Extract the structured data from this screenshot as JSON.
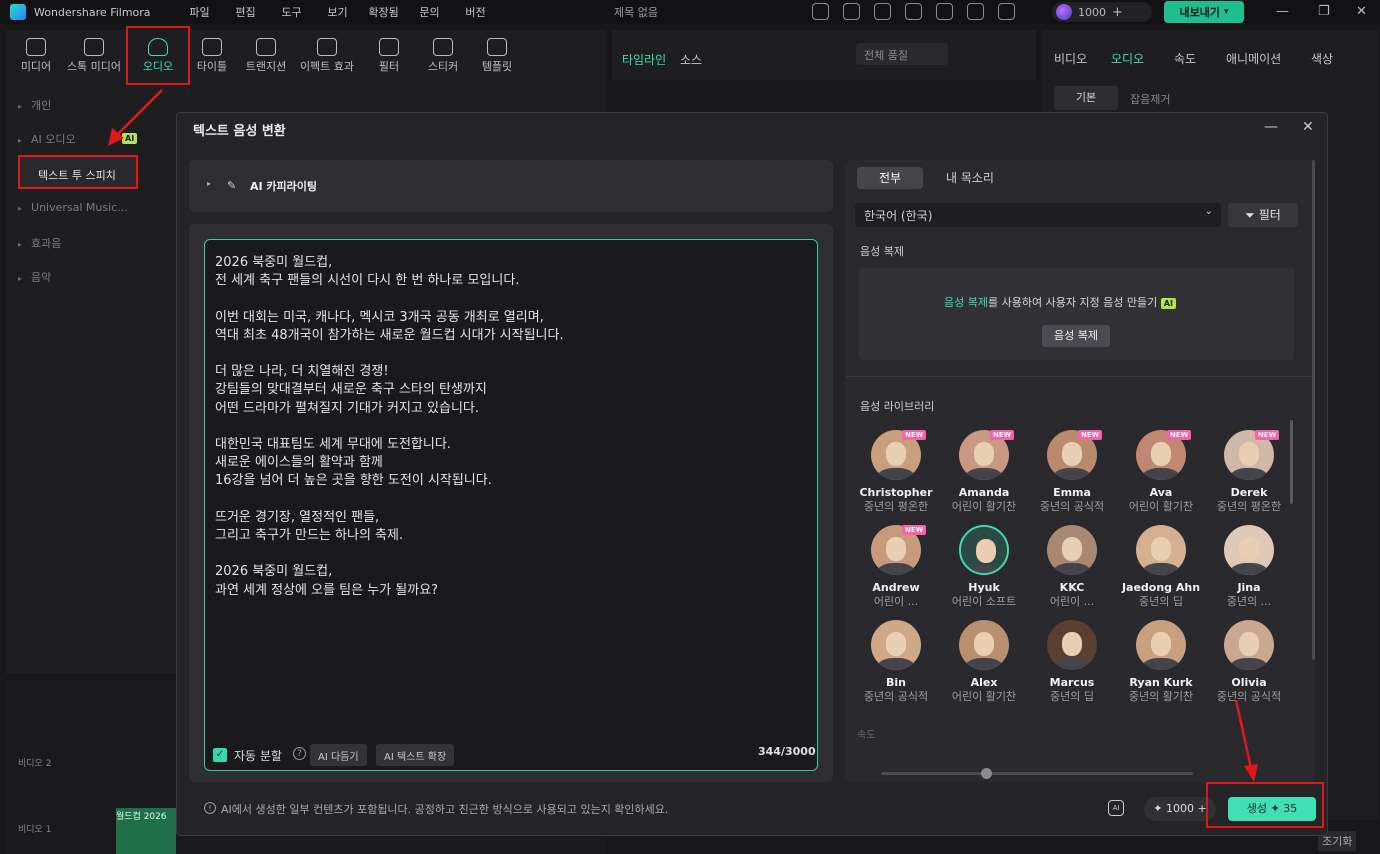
{
  "app": {
    "name": "Wondershare Filmora",
    "menu": [
      "파일",
      "편집",
      "도구",
      "보기",
      "확장됨",
      "문의",
      "버전"
    ],
    "project_title": "제목 없음",
    "credits": "1000",
    "export_label": "내보내기"
  },
  "toolbar": {
    "items": [
      "미디어",
      "스톡 미디어",
      "오디오",
      "타이틀",
      "트랜지션",
      "이펙트 효과",
      "필터",
      "스티커",
      "템플릿"
    ]
  },
  "sidebar": {
    "items": [
      "개인",
      "AI 오디오",
      "텍스트 투 스피치",
      "Universal Music...",
      "효과음",
      "음악"
    ],
    "ai_tag": "AI"
  },
  "middle": {
    "tabs": [
      "타임라인",
      "소스"
    ],
    "quality": "전체 품질"
  },
  "right_panel": {
    "tabs": [
      "비디오",
      "오디오",
      "속도",
      "애니메이션",
      "색상"
    ],
    "subtabs": [
      "기본",
      "잡음제거"
    ]
  },
  "timeline": {
    "tracks": [
      "비디오 2",
      "비디오 1"
    ],
    "clip": "월드컵 2026"
  },
  "dialog": {
    "title": "텍스트 음성 변환",
    "copywriting_label": "AI 카피라이팅",
    "text": "2026 북중미 월드컵,\n전 세계 축구 팬들의 시선이 다시 한 번 하나로 모입니다.\n\n이번 대회는 미국, 캐나다, 멕시코 3개국 공동 개최로 열리며,\n역대 최초 48개국이 참가하는 새로운 월드컵 시대가 시작됩니다.\n\n더 많은 나라, 더 치열해진 경쟁!\n강팀들의 맞대결부터 새로운 축구 스타의 탄생까지\n어떤 드라마가 펼쳐질지 기대가 커지고 있습니다.\n\n대한민국 대표팀도 세계 무대에 도전합니다.\n새로운 에이스들의 활약과 함께\n16강을 넘어 더 높은 곳을 향한 도전이 시작됩니다.\n\n뜨거운 경기장, 열정적인 팬들,\n그리고 축구가 만드는 하나의 축제.\n\n2026 북중미 월드컵,\n과연 세계 정상에 오를 팀은 누가 될까요?",
    "auto_split": "자동 분할",
    "polish": "AI 다듬기",
    "expand": "AI 텍스트 확장",
    "char_count": "344/3000",
    "disclaimer": "AI에서 생성한 일부 컨텐츠가 포함됩니다. 공정하고 친근한 방식으로 사용되고 있는지 확인하세요.",
    "voice_tabs": [
      "전부",
      "내 목소리"
    ],
    "language": "한국어 (한국)",
    "filter": "필터",
    "clone_section": "음성 복제",
    "clone_prompt_link": "음성 복제",
    "clone_prompt_rest": "를 사용하여 사용자 지정 음성 만들기",
    "clone_button": "음성 복제",
    "library_label": "음성 라이브러리",
    "new_tag": "NEW",
    "voices": [
      {
        "name": "Christopher",
        "desc": "중년의 평온한"
      },
      {
        "name": "Amanda",
        "desc": "어린이 활기찬"
      },
      {
        "name": "Emma",
        "desc": "중년의 공식적"
      },
      {
        "name": "Ava",
        "desc": "어린이 활기찬"
      },
      {
        "name": "Derek",
        "desc": "중년의 평온한"
      },
      {
        "name": "Andrew",
        "desc": "어린이 ..."
      },
      {
        "name": "Hyuk",
        "desc": "어린이 소프트"
      },
      {
        "name": "KKC",
        "desc": "어린이 ..."
      },
      {
        "name": "Jaedong Ahn",
        "desc": "중년의 딥"
      },
      {
        "name": "Jina",
        "desc": "중년의 ..."
      },
      {
        "name": "Bin",
        "desc": "중년의 공식적"
      },
      {
        "name": "Alex",
        "desc": "어린이 활기찬"
      },
      {
        "name": "Marcus",
        "desc": "중년의 딥"
      },
      {
        "name": "Ryan Kurk",
        "desc": "중년의 활기찬"
      },
      {
        "name": "Olivia",
        "desc": "중년의 공식적"
      }
    ],
    "speed_label": "속도",
    "footer_credits": "1000",
    "generate_label": "생성",
    "generate_cost": "35"
  },
  "bottom_right": "조기화"
}
